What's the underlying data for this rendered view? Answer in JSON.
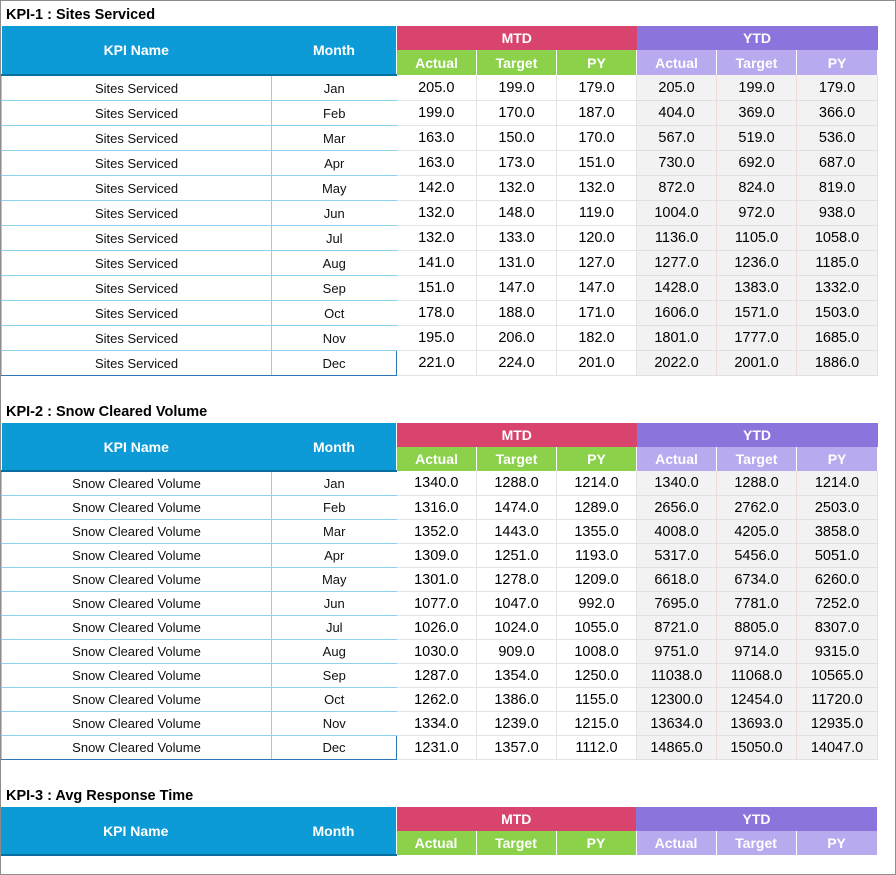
{
  "headers": {
    "kpi_name": "KPI Name",
    "month": "Month",
    "mtd": "MTD",
    "ytd": "YTD",
    "actual": "Actual",
    "target": "Target",
    "py": "PY"
  },
  "kpis": [
    {
      "title": "KPI-1 : Sites Serviced",
      "name": "Sites Serviced",
      "rows": [
        {
          "month": "Jan",
          "mtd": [
            "205.0",
            "199.0",
            "179.0"
          ],
          "ytd": [
            "205.0",
            "199.0",
            "179.0"
          ]
        },
        {
          "month": "Feb",
          "mtd": [
            "199.0",
            "170.0",
            "187.0"
          ],
          "ytd": [
            "404.0",
            "369.0",
            "366.0"
          ]
        },
        {
          "month": "Mar",
          "mtd": [
            "163.0",
            "150.0",
            "170.0"
          ],
          "ytd": [
            "567.0",
            "519.0",
            "536.0"
          ]
        },
        {
          "month": "Apr",
          "mtd": [
            "163.0",
            "173.0",
            "151.0"
          ],
          "ytd": [
            "730.0",
            "692.0",
            "687.0"
          ]
        },
        {
          "month": "May",
          "mtd": [
            "142.0",
            "132.0",
            "132.0"
          ],
          "ytd": [
            "872.0",
            "824.0",
            "819.0"
          ]
        },
        {
          "month": "Jun",
          "mtd": [
            "132.0",
            "148.0",
            "119.0"
          ],
          "ytd": [
            "1004.0",
            "972.0",
            "938.0"
          ]
        },
        {
          "month": "Jul",
          "mtd": [
            "132.0",
            "133.0",
            "120.0"
          ],
          "ytd": [
            "1136.0",
            "1105.0",
            "1058.0"
          ]
        },
        {
          "month": "Aug",
          "mtd": [
            "141.0",
            "131.0",
            "127.0"
          ],
          "ytd": [
            "1277.0",
            "1236.0",
            "1185.0"
          ]
        },
        {
          "month": "Sep",
          "mtd": [
            "151.0",
            "147.0",
            "147.0"
          ],
          "ytd": [
            "1428.0",
            "1383.0",
            "1332.0"
          ]
        },
        {
          "month": "Oct",
          "mtd": [
            "178.0",
            "188.0",
            "171.0"
          ],
          "ytd": [
            "1606.0",
            "1571.0",
            "1503.0"
          ]
        },
        {
          "month": "Nov",
          "mtd": [
            "195.0",
            "206.0",
            "182.0"
          ],
          "ytd": [
            "1801.0",
            "1777.0",
            "1685.0"
          ]
        },
        {
          "month": "Dec",
          "mtd": [
            "221.0",
            "224.0",
            "201.0"
          ],
          "ytd": [
            "2022.0",
            "2001.0",
            "1886.0"
          ]
        }
      ]
    },
    {
      "title": "KPI-2 : Snow Cleared Volume",
      "name": "Snow Cleared Volume",
      "rows": [
        {
          "month": "Jan",
          "mtd": [
            "1340.0",
            "1288.0",
            "1214.0"
          ],
          "ytd": [
            "1340.0",
            "1288.0",
            "1214.0"
          ]
        },
        {
          "month": "Feb",
          "mtd": [
            "1316.0",
            "1474.0",
            "1289.0"
          ],
          "ytd": [
            "2656.0",
            "2762.0",
            "2503.0"
          ]
        },
        {
          "month": "Mar",
          "mtd": [
            "1352.0",
            "1443.0",
            "1355.0"
          ],
          "ytd": [
            "4008.0",
            "4205.0",
            "3858.0"
          ]
        },
        {
          "month": "Apr",
          "mtd": [
            "1309.0",
            "1251.0",
            "1193.0"
          ],
          "ytd": [
            "5317.0",
            "5456.0",
            "5051.0"
          ]
        },
        {
          "month": "May",
          "mtd": [
            "1301.0",
            "1278.0",
            "1209.0"
          ],
          "ytd": [
            "6618.0",
            "6734.0",
            "6260.0"
          ]
        },
        {
          "month": "Jun",
          "mtd": [
            "1077.0",
            "1047.0",
            "992.0"
          ],
          "ytd": [
            "7695.0",
            "7781.0",
            "7252.0"
          ]
        },
        {
          "month": "Jul",
          "mtd": [
            "1026.0",
            "1024.0",
            "1055.0"
          ],
          "ytd": [
            "8721.0",
            "8805.0",
            "8307.0"
          ]
        },
        {
          "month": "Aug",
          "mtd": [
            "1030.0",
            "909.0",
            "1008.0"
          ],
          "ytd": [
            "9751.0",
            "9714.0",
            "9315.0"
          ]
        },
        {
          "month": "Sep",
          "mtd": [
            "1287.0",
            "1354.0",
            "1250.0"
          ],
          "ytd": [
            "11038.0",
            "11068.0",
            "10565.0"
          ]
        },
        {
          "month": "Oct",
          "mtd": [
            "1262.0",
            "1386.0",
            "1155.0"
          ],
          "ytd": [
            "12300.0",
            "12454.0",
            "11720.0"
          ]
        },
        {
          "month": "Nov",
          "mtd": [
            "1334.0",
            "1239.0",
            "1215.0"
          ],
          "ytd": [
            "13634.0",
            "13693.0",
            "12935.0"
          ]
        },
        {
          "month": "Dec",
          "mtd": [
            "1231.0",
            "1357.0",
            "1112.0"
          ],
          "ytd": [
            "14865.0",
            "15050.0",
            "14047.0"
          ]
        }
      ]
    },
    {
      "title": "KPI-3 : Avg Response Time",
      "name": "",
      "rows": []
    }
  ]
}
